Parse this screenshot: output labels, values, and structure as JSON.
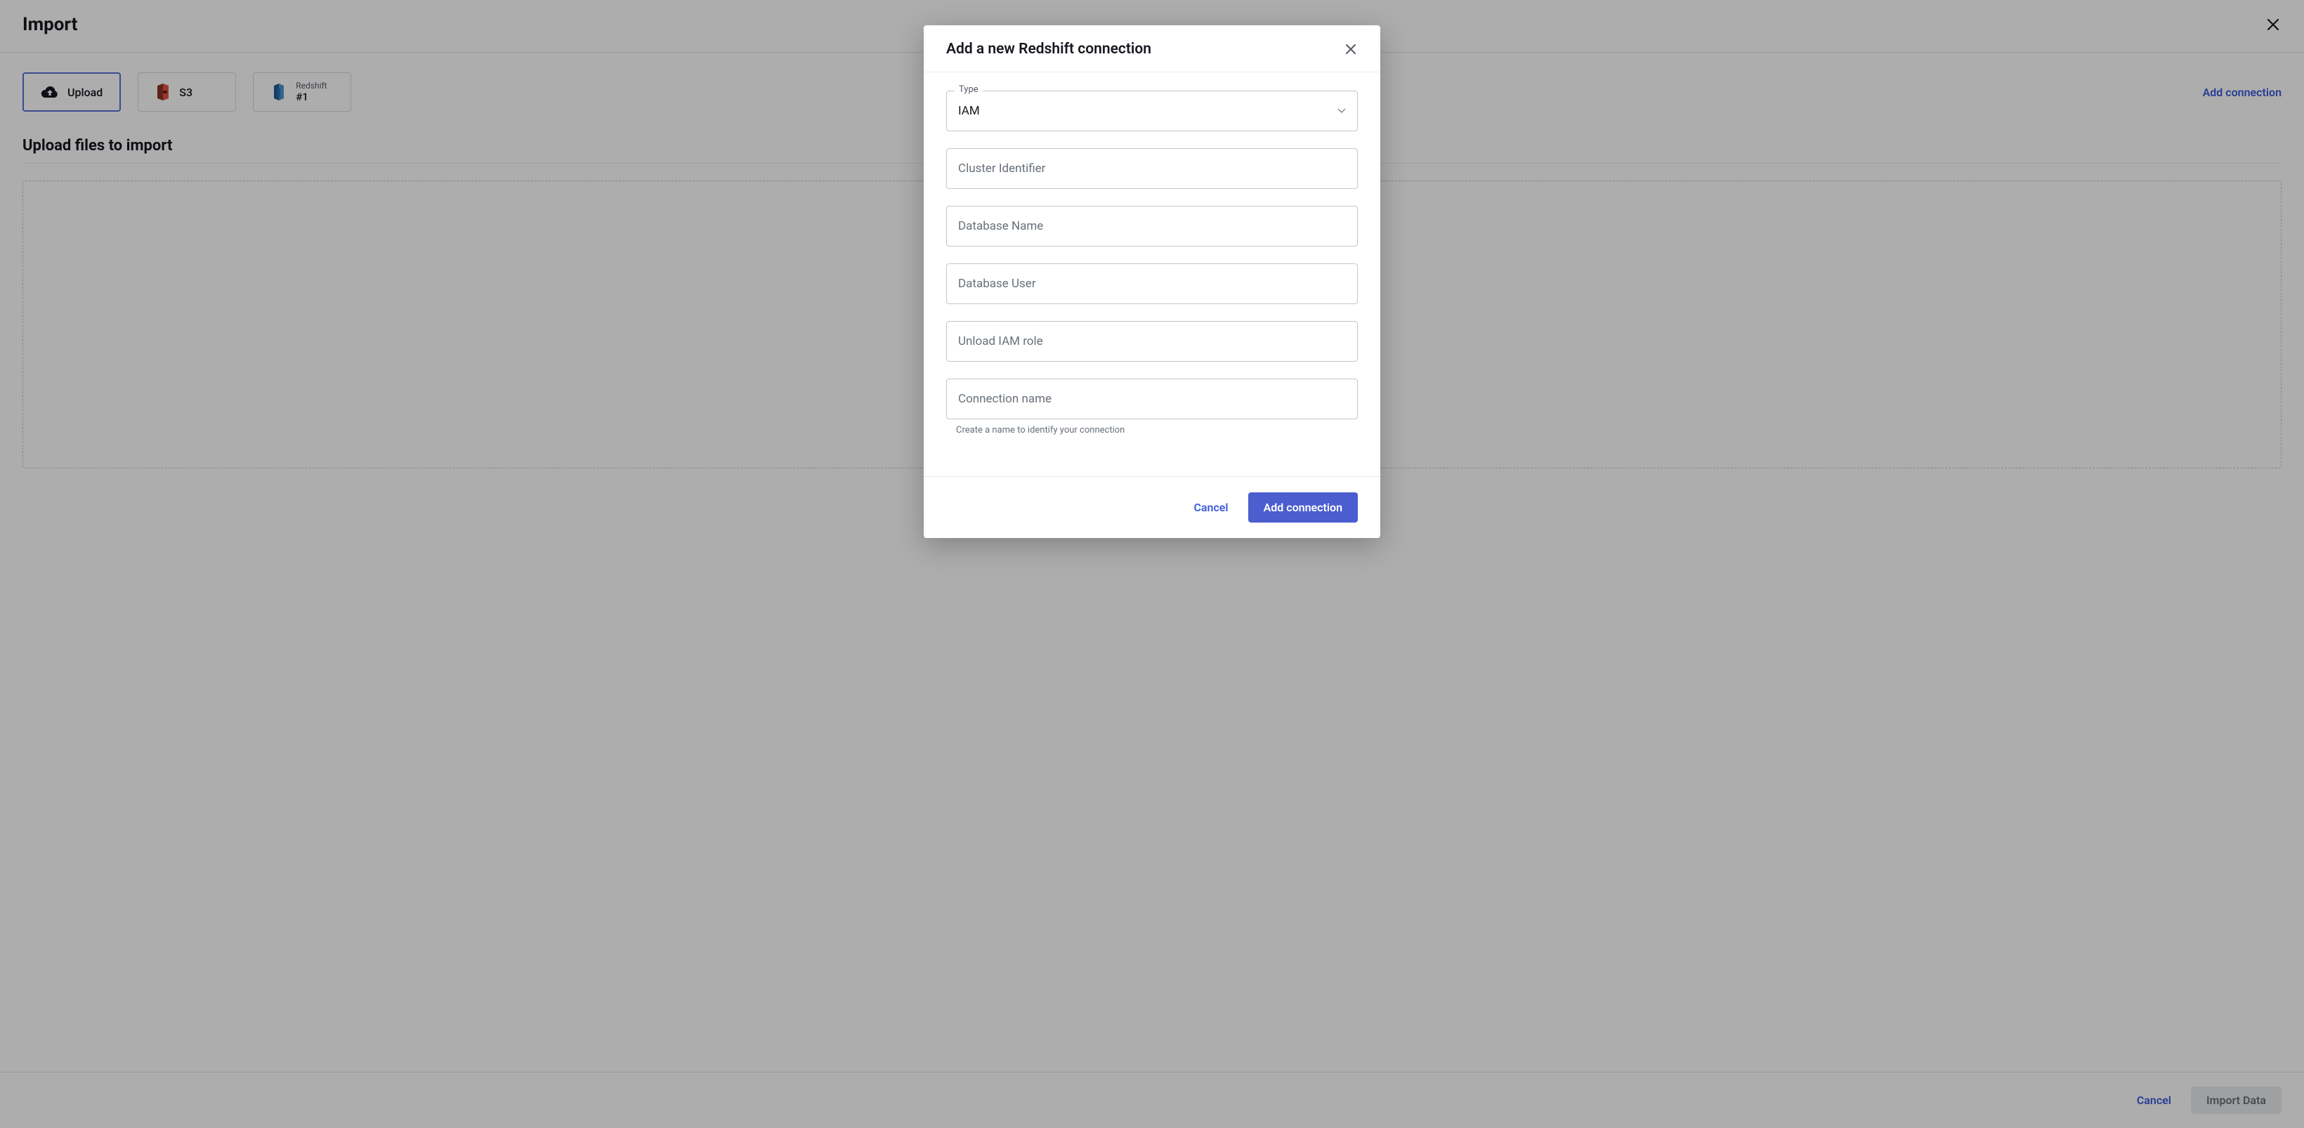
{
  "page": {
    "title": "Import",
    "add_connection": "Add connection",
    "section_title": "Upload files to import",
    "footer_cancel": "Cancel",
    "footer_import": "Import Data"
  },
  "tabs": {
    "upload": "Upload",
    "s3": "S3",
    "redshift_top": "Redshift",
    "redshift_bottom": "#1"
  },
  "modal": {
    "title": "Add a new Redshift connection",
    "type_label": "Type",
    "type_value": "IAM",
    "fields": {
      "cluster_identifier": "Cluster Identifier",
      "database_name": "Database Name",
      "database_user": "Database User",
      "unload_iam_role": "Unload IAM role",
      "connection_name": "Connection name"
    },
    "connection_name_helper": "Create a name to identify your connection",
    "footer_cancel": "Cancel",
    "footer_add": "Add connection"
  }
}
